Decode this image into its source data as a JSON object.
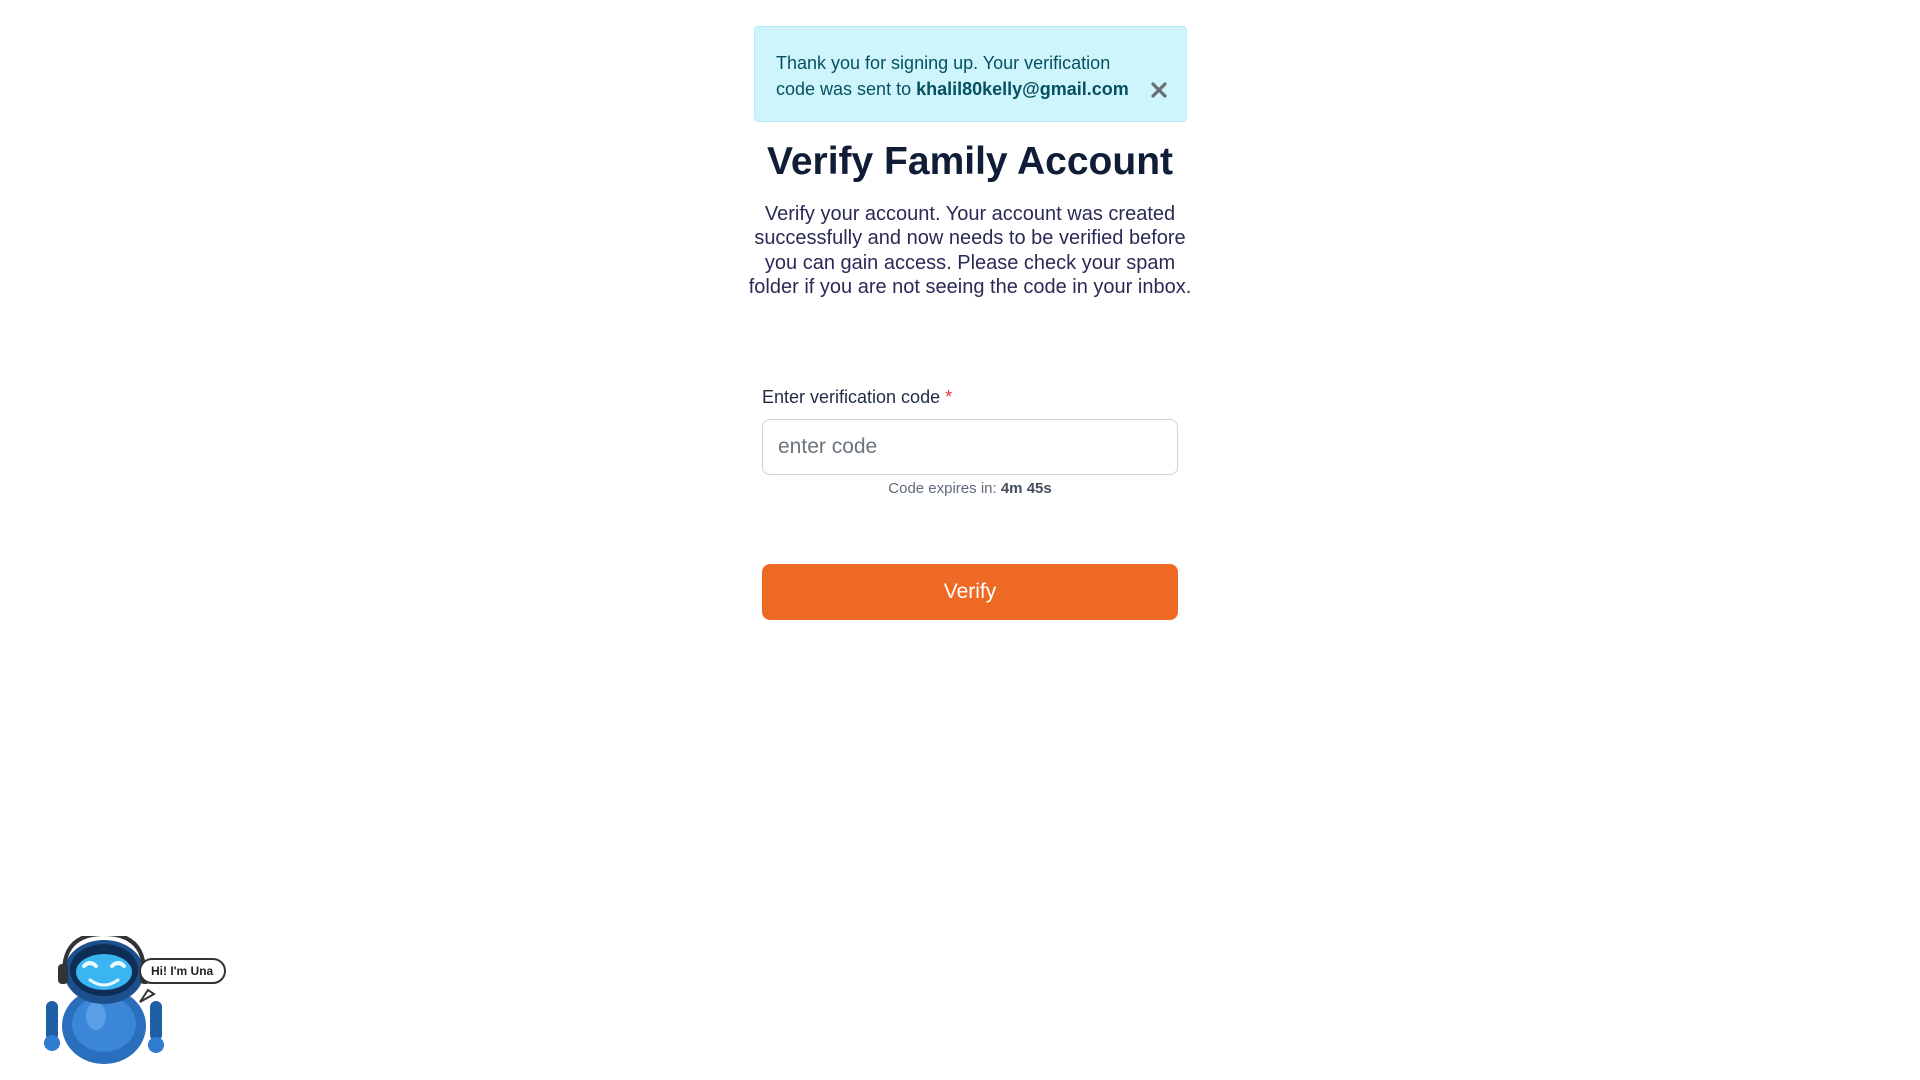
{
  "alert": {
    "message": "Thank you for signing up. Your verification code was sent to",
    "email": "khalil80kelly@gmail.com",
    "close_icon": "close-icon",
    "color": "#cef4fc"
  },
  "page": {
    "title": "Verify Family Account",
    "description": "Verify your account. Your account was created successfully and now needs to be verified before you can gain access. Please check your spam folder if you are not seeing the code in your inbox."
  },
  "form": {
    "code_label": "Enter verification code",
    "required_marker": "*",
    "code_placeholder": "enter code",
    "code_value": "",
    "expires_label": "Code expires in:",
    "expires_time": "4m 45s",
    "verify_label": "Verify",
    "accent_color": "#ee6a24"
  },
  "assistant": {
    "greeting": "Hi! I'm Una",
    "icon": "robot-icon"
  }
}
